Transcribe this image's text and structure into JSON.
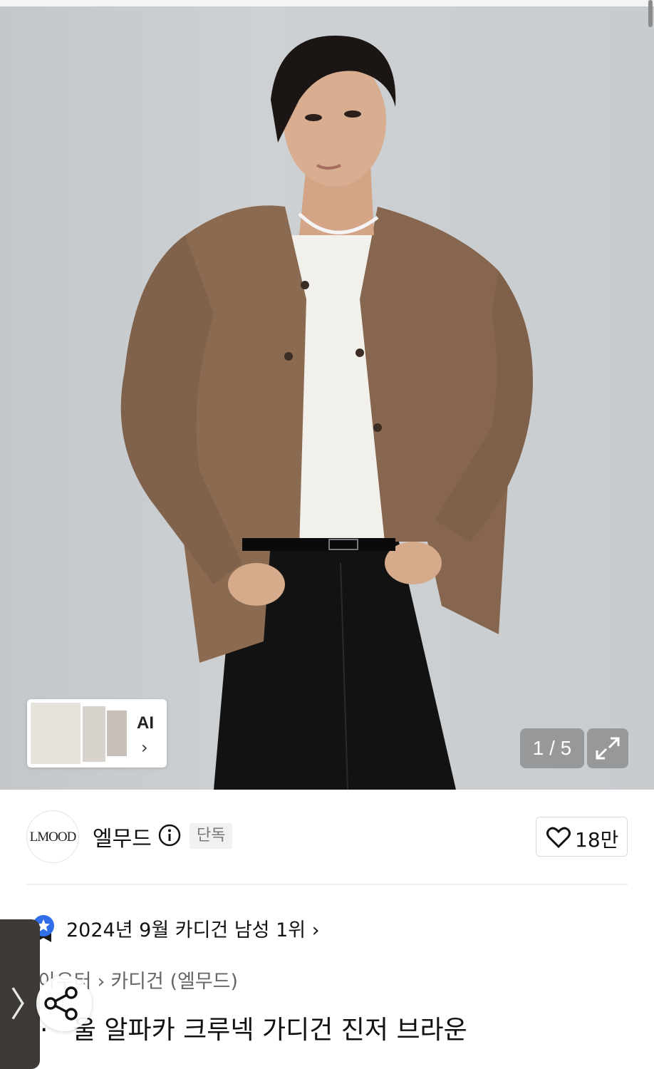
{
  "gallery": {
    "counter": "1 / 5",
    "ai_card_label": "AI"
  },
  "brand": {
    "logo_text": "LMOOD",
    "name": "엘무드",
    "exclusive_badge": "단독",
    "like_count": "18만"
  },
  "ranking": {
    "text": "2024년 9월 카디건 남성 1위"
  },
  "breadcrumb": {
    "items": [
      "아우터",
      "카디건 (엘무드)"
    ]
  },
  "product": {
    "title": "울 알파카 크루넥 가디건 진저 브라운"
  },
  "colors": {
    "accent_blue": "#2f6ee8",
    "cardigan": "#8b6a52",
    "pants": "#121212"
  },
  "icons": [
    "info-icon",
    "heart-icon",
    "expand-icon",
    "share-icon",
    "chevron-right-icon",
    "rank-badge-icon"
  ]
}
